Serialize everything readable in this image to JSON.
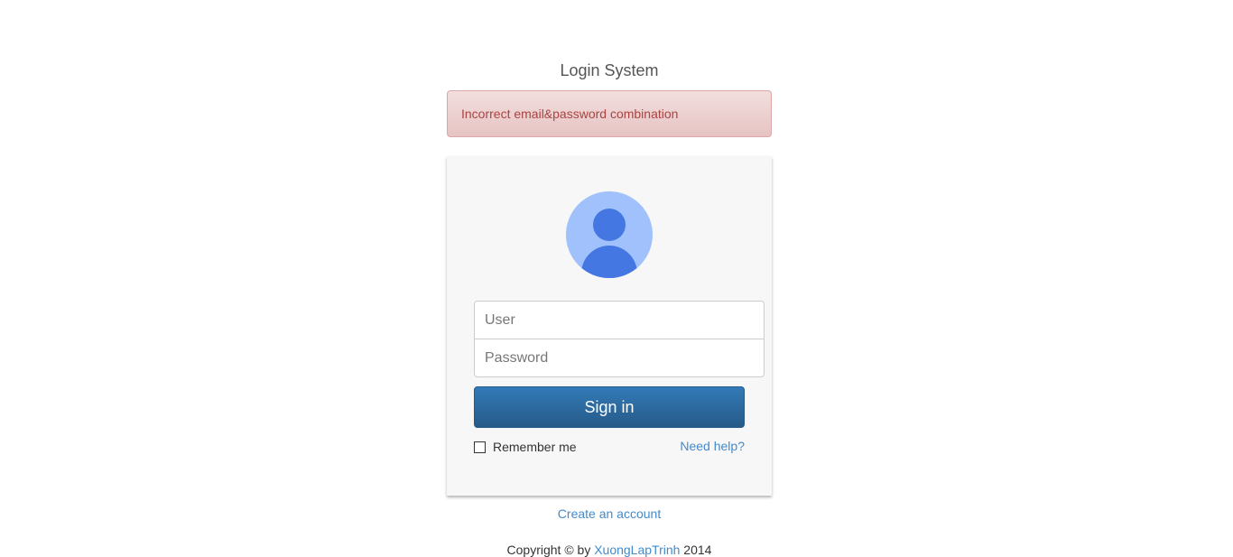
{
  "page": {
    "title": "Login System"
  },
  "alert": {
    "message": "Incorrect email&password combination"
  },
  "login_form": {
    "user_placeholder": "User",
    "password_placeholder": "Password",
    "signin_label": "Sign in",
    "remember_label": "Remember me",
    "remember_checked": false,
    "need_help_label": "Need help?"
  },
  "links": {
    "create_account": "Create an account"
  },
  "footer": {
    "prefix": "Copyright © by ",
    "link_text": "XuongLapTrinh",
    "suffix": " 2014"
  },
  "colors": {
    "alert_text": "#a94442",
    "alert_bg": "#f2dede",
    "primary": "#337ab7",
    "link": "#428bca",
    "avatar_light": "#a0c1fc",
    "avatar_dark": "#4477e2"
  },
  "icons": {
    "avatar": "user-avatar-icon"
  }
}
